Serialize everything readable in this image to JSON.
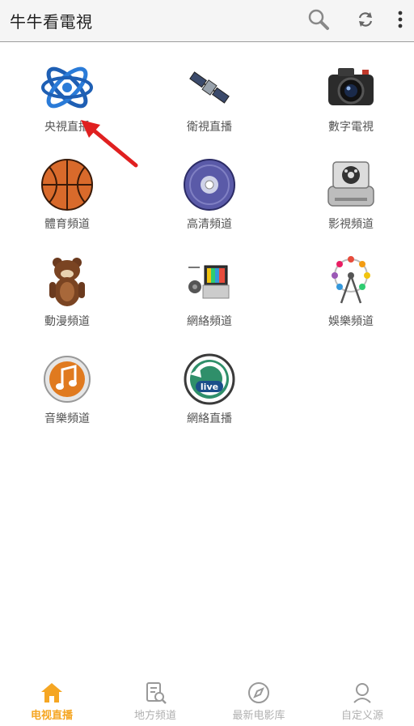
{
  "app": {
    "title": "牛牛看電視"
  },
  "toolbar": {
    "icons": [
      "search-icon",
      "refresh-icon",
      "more-vert-icon"
    ]
  },
  "channels": [
    {
      "label": "央視直播",
      "icon": "atom-cctv-icon"
    },
    {
      "label": "衛視直播",
      "icon": "satellite-icon"
    },
    {
      "label": "數字電視",
      "icon": "camera-icon"
    },
    {
      "label": "體育頻道",
      "icon": "basketball-icon"
    },
    {
      "label": "高清頻道",
      "icon": "disc-icon"
    },
    {
      "label": "影視頻道",
      "icon": "film-drive-icon"
    },
    {
      "label": "動漫頻道",
      "icon": "bear-icon"
    },
    {
      "label": "網絡頻道",
      "icon": "retro-tv-icon"
    },
    {
      "label": "娛樂頻道",
      "icon": "ferris-wheel-icon"
    },
    {
      "label": "音樂頻道",
      "icon": "music-note-icon"
    },
    {
      "label": "網絡直播",
      "icon": "live-icon"
    }
  ],
  "bottom_nav": [
    {
      "label": "电视直播",
      "icon": "home-icon",
      "active": true
    },
    {
      "label": "地方频道",
      "icon": "document-search-icon",
      "active": false
    },
    {
      "label": "最新电影库",
      "icon": "compass-icon",
      "active": false
    },
    {
      "label": "自定义源",
      "icon": "person-icon",
      "active": false
    }
  ],
  "colors": {
    "accent": "#f5a623",
    "arrow": "#e02020",
    "appbar_bg": "#f5f5f5"
  }
}
